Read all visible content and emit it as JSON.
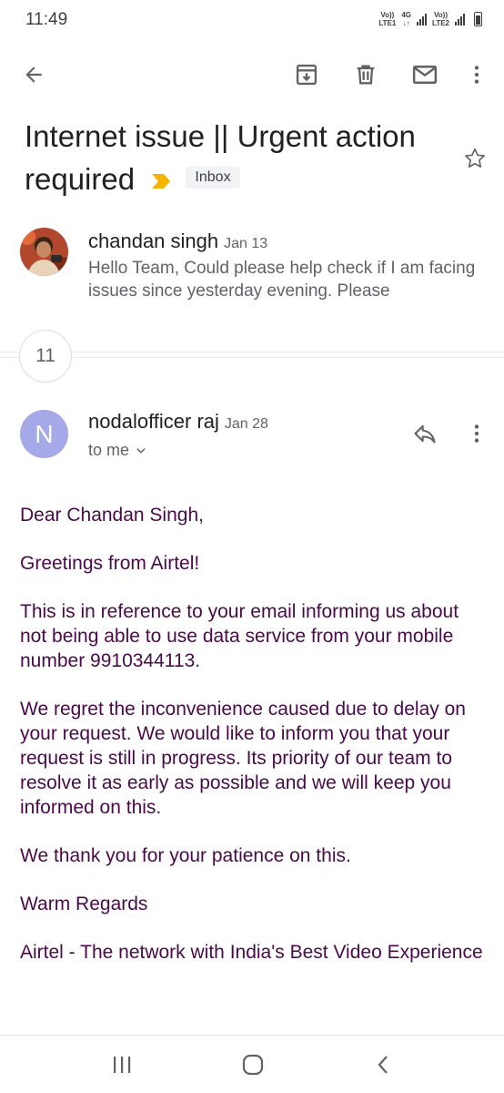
{
  "status_bar": {
    "time": "11:49",
    "sim1_label_top": "Vo))",
    "sim1_label_bottom": "LTE1",
    "net_type_top": "4G",
    "net_type_bottom": "↓↑",
    "sim2_label_top": "Vo))",
    "sim2_label_bottom": "LTE2"
  },
  "toolbar": {
    "icons": [
      "back-arrow-icon",
      "archive-icon",
      "delete-icon",
      "mail-icon",
      "more-vert-icon"
    ]
  },
  "thread": {
    "subject": "Internet issue || Urgent action required",
    "label": "Inbox",
    "importance_color": "#f4b400"
  },
  "collapsed_message": {
    "sender": "chandan singh",
    "date": "Jan 13",
    "snippet": "Hello Team, Could please help check if I am facing issues since yesterday evening. Please"
  },
  "collapsed_count": "11",
  "open_message": {
    "avatar_letter": "N",
    "avatar_color": "#a5a9e8",
    "sender": "nodalofficer raj",
    "date": "Jan 28",
    "recipient": "to me",
    "body": [
      "Dear Chandan Singh,",
      "Greetings from Airtel!",
      "This is in reference to your email informing us about not being able to use data service from your mobile number 9910344113.",
      "We regret the inconvenience caused due to delay on your request. We would like to inform you that your request is still in progress. Its priority of our team to resolve it as early as possible and we will keep you informed on this.",
      "We thank you for your patience on this.",
      "Warm Regards",
      "Airtel - The network with India's Best Video Experience"
    ],
    "body_color": "#4a0a4a"
  },
  "navbar": {
    "icons": [
      "recent-apps-icon",
      "home-icon",
      "back-icon"
    ]
  }
}
